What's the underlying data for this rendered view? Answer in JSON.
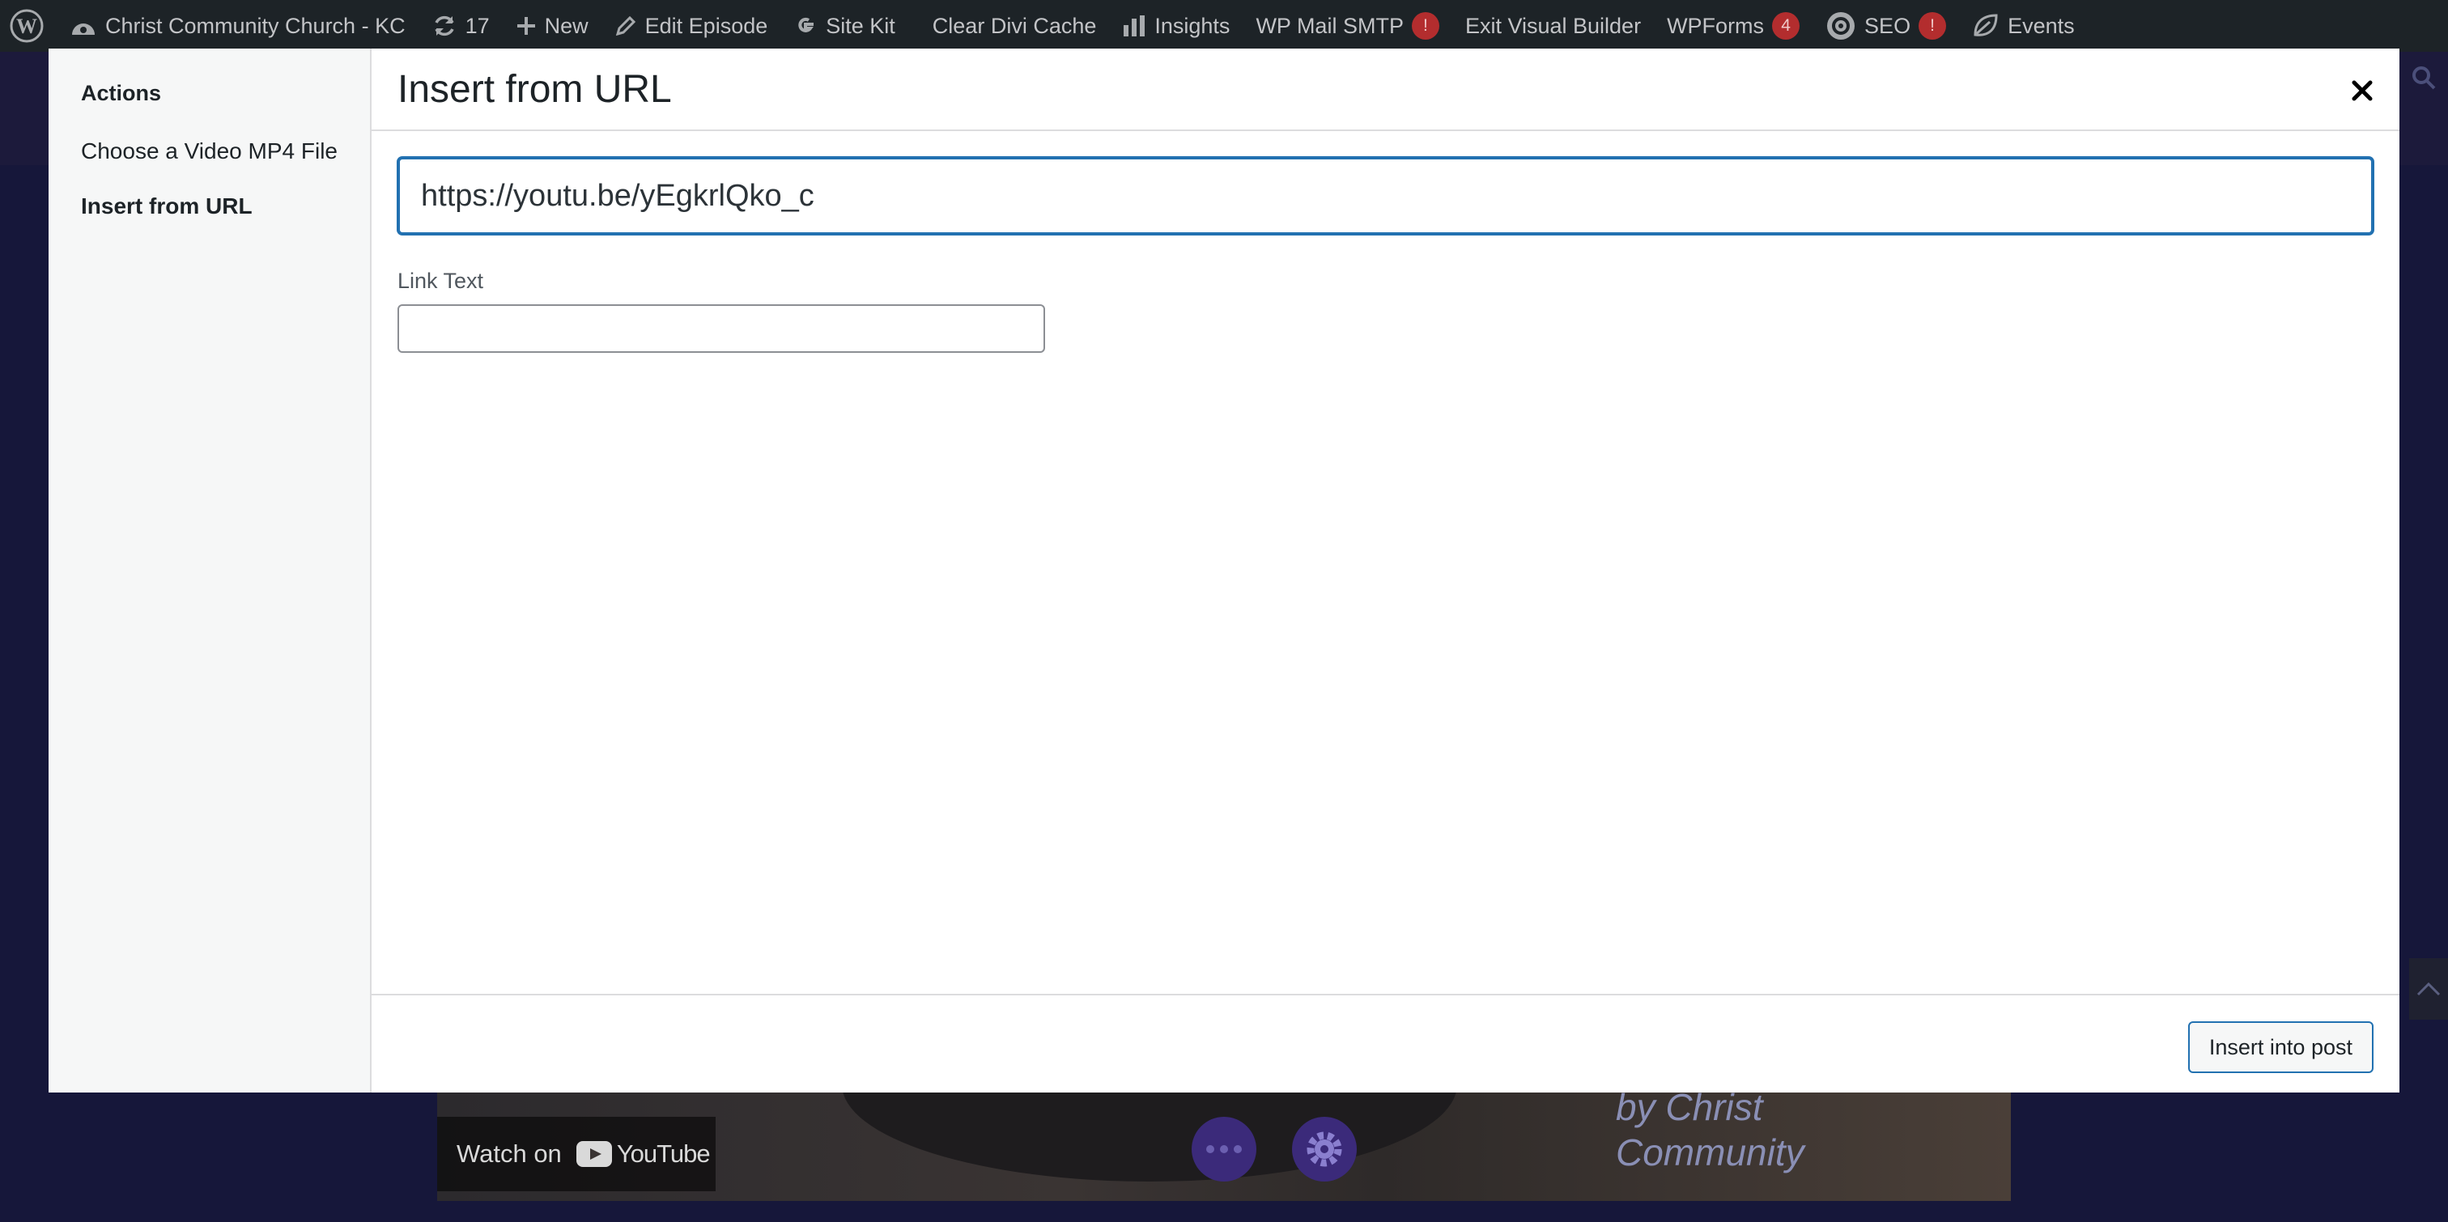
{
  "admin_bar": {
    "site_name": "Christ Community Church - KC",
    "updates_count": "17",
    "new_label": "New",
    "edit_label": "Edit Episode",
    "site_kit_label": "Site Kit",
    "clear_cache_label": "Clear Divi Cache",
    "insights_label": "Insights",
    "wp_mail_label": "WP Mail SMTP",
    "wp_mail_badge": "!",
    "exit_builder_label": "Exit Visual Builder",
    "wpforms_label": "WPForms",
    "wpforms_badge": "4",
    "seo_label": "SEO",
    "seo_badge": "!",
    "events_label": "Events"
  },
  "background": {
    "watch_on_label": "Watch on",
    "youtube_label": "YouTube",
    "video_overlay_text": "by Christ Community"
  },
  "modal": {
    "sidebar": {
      "heading": "Actions",
      "items": [
        {
          "label": "Choose a Video MP4 File",
          "active": false
        },
        {
          "label": "Insert from URL",
          "active": true
        }
      ]
    },
    "title": "Insert from URL",
    "url_value": "https://youtu.be/yEgkrlQko_c",
    "link_text_label": "Link Text",
    "link_text_value": "",
    "insert_button_label": "Insert into post"
  },
  "colors": {
    "admin_bar_bg": "#1d2327",
    "accent": "#2271b1",
    "badge_red": "#b32d2e",
    "page_bg": "#16173a"
  }
}
